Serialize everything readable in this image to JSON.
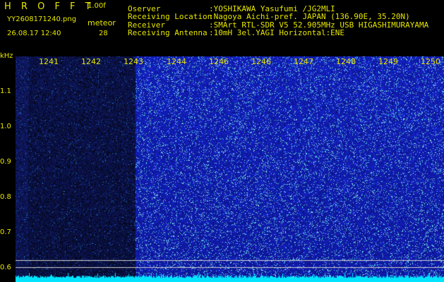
{
  "header": {
    "app_title": "H R O F F T",
    "version": "1.00f",
    "filename": "YY2608171240.png",
    "datetime": "26.08.17 12:40",
    "meteor_label": "meteor",
    "meteor_count": "28",
    "observer_label": "Oserver",
    "observer_value": ":YOSHIKAWA Yasufumi /JG2MLI",
    "location_label": "Receiving Location",
    "location_value": ":Nagoya Aichi-pref. JAPAN (136.90E, 35.20N)",
    "receiver_label": "Receiver",
    "receiver_value": ":SMArt RTL-SDR V5 52.905MHz USB HIGASHIMURAYAMA",
    "antenna_label": "Receiving Antenna",
    "antenna_value": ":10mH 3el.YAGI Horizontal:ENE"
  },
  "plot": {
    "y_unit": "kHz",
    "y_ticks": [
      "1.1",
      "1.0",
      "0.9",
      "0.8",
      "0.7",
      "0.6"
    ],
    "x_ticks": [
      "1241",
      "1242",
      "1243",
      "1244",
      "1246",
      "1246",
      "1247",
      "1248",
      "1249",
      "1250"
    ]
  },
  "colors": {
    "text": "#e6e600",
    "background": "#000000",
    "spectrogram_low": "#0a0a70",
    "spectrogram_high": "#1a28d8",
    "baseline": "#00e5ff"
  }
}
